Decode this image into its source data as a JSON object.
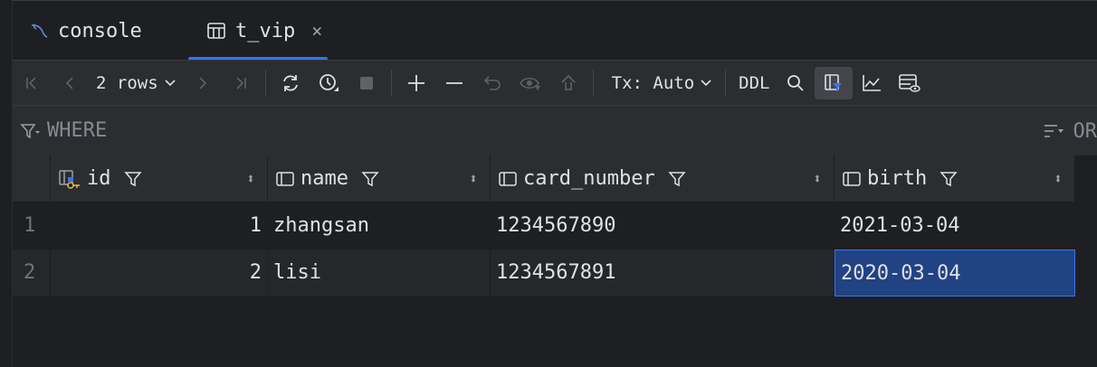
{
  "tabs": [
    {
      "label": "console",
      "icon": "mysql-console-icon"
    },
    {
      "label": "t_vip",
      "icon": "table-icon",
      "active": true,
      "close": "×"
    }
  ],
  "toolbar": {
    "rows_label": "2 rows",
    "tx_label": "Tx: Auto",
    "ddl_label": "DDL"
  },
  "filter": {
    "where_label": "WHERE",
    "orderby_label": "OR"
  },
  "table": {
    "columns": [
      {
        "name": "id",
        "icon": "primary-key-icon"
      },
      {
        "name": "name",
        "icon": "column-icon"
      },
      {
        "name": "card_number",
        "icon": "column-icon"
      },
      {
        "name": "birth",
        "icon": "column-icon"
      }
    ],
    "sort_glyph": "⬍",
    "rows": [
      {
        "num": "1",
        "id": "1",
        "name": "zhangsan",
        "card_number": "1234567890",
        "birth": "2021-03-04"
      },
      {
        "num": "2",
        "id": "2",
        "name": "lisi",
        "card_number": "1234567891",
        "birth": "2020-03-04"
      }
    ],
    "selected_cell": "rows.1.birth"
  },
  "colors": {
    "background": "#1e1f22",
    "toolbar": "#2b2d30",
    "accent": "#3574f0",
    "selection": "#214283"
  }
}
